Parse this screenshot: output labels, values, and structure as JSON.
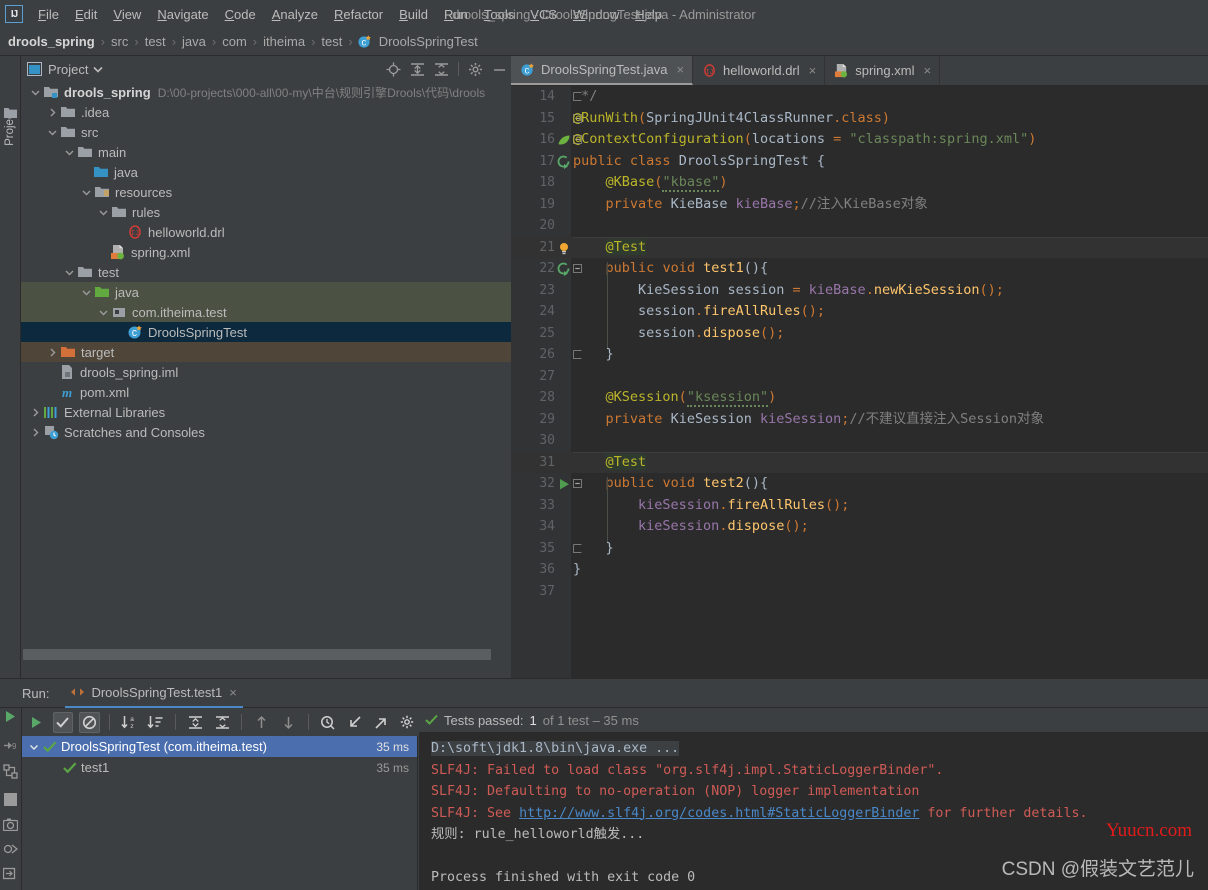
{
  "window": {
    "title": "drools_spring - DroolsSpringTest.java - Administrator"
  },
  "menubar": {
    "items": [
      {
        "label": "File"
      },
      {
        "label": "Edit"
      },
      {
        "label": "View"
      },
      {
        "label": "Navigate"
      },
      {
        "label": "Code"
      },
      {
        "label": "Analyze"
      },
      {
        "label": "Refactor"
      },
      {
        "label": "Build"
      },
      {
        "label": "Run"
      },
      {
        "label": "Tools"
      },
      {
        "label": "VCS"
      },
      {
        "label": "Window"
      },
      {
        "label": "Help"
      }
    ]
  },
  "breadcrumb": {
    "items": [
      {
        "label": "drools_spring",
        "bold": true
      },
      {
        "label": "src"
      },
      {
        "label": "test"
      },
      {
        "label": "java"
      },
      {
        "label": "com"
      },
      {
        "label": "itheima"
      },
      {
        "label": "test"
      },
      {
        "label": "DroolsSpringTest",
        "icon": "java-class-icon"
      }
    ],
    "separator": "›"
  },
  "left_strip": {
    "project_tab": "Project"
  },
  "project_panel": {
    "title": "Project",
    "dropdown_icon": "chevron-down-icon",
    "tools": [
      {
        "name": "locate-icon"
      },
      {
        "name": "expand-all-icon"
      },
      {
        "name": "collapse-all-icon"
      },
      {
        "name": "gear-icon"
      },
      {
        "name": "minimize-icon"
      }
    ],
    "tree": [
      {
        "label": "drools_spring",
        "path": "D:\\00-projects\\000-all\\00-my\\中台\\规则引擎Drools\\代码\\drools",
        "indent": 0,
        "arrow": "down",
        "icon": "module-icon",
        "bold": true
      },
      {
        "label": ".idea",
        "indent": 1,
        "arrow": "right",
        "icon": "folder-icon"
      },
      {
        "label": "src",
        "indent": 1,
        "arrow": "down",
        "icon": "folder-icon"
      },
      {
        "label": "main",
        "indent": 2,
        "arrow": "down",
        "icon": "folder-icon"
      },
      {
        "label": "java",
        "indent": 3,
        "arrow": "none",
        "icon": "folder-source-icon"
      },
      {
        "label": "resources",
        "indent": 3,
        "arrow": "down",
        "icon": "folder-resource-icon"
      },
      {
        "label": "rules",
        "indent": 4,
        "arrow": "down",
        "icon": "folder-icon"
      },
      {
        "label": "helloworld.drl",
        "indent": 5,
        "arrow": "none",
        "icon": "drl-file-icon"
      },
      {
        "label": "spring.xml",
        "indent": 4,
        "arrow": "none",
        "icon": "spring-xml-icon"
      },
      {
        "label": "test",
        "indent": 2,
        "arrow": "down",
        "icon": "folder-icon"
      },
      {
        "label": "java",
        "indent": 3,
        "arrow": "down",
        "icon": "folder-test-source-icon",
        "row": "srcroot"
      },
      {
        "label": "com.itheima.test",
        "indent": 4,
        "arrow": "down",
        "icon": "package-test-icon",
        "row": "srcroot"
      },
      {
        "label": "DroolsSpringTest",
        "indent": 5,
        "arrow": "none",
        "icon": "java-class-icon",
        "row": "sel"
      },
      {
        "label": "target",
        "indent": 1,
        "arrow": "right",
        "icon": "folder-excluded-icon",
        "row": "target"
      },
      {
        "label": "drools_spring.iml",
        "indent": 1,
        "arrow": "none",
        "icon": "iml-file-icon"
      },
      {
        "label": "pom.xml",
        "indent": 1,
        "arrow": "none",
        "icon": "maven-icon"
      },
      {
        "label": "External Libraries",
        "indent": 0,
        "arrow": "right",
        "icon": "libraries-icon"
      },
      {
        "label": "Scratches and Consoles",
        "indent": 0,
        "arrow": "right",
        "icon": "scratches-icon"
      }
    ]
  },
  "editor_tabs": [
    {
      "label": "DroolsSpringTest.java",
      "icon": "java-class-icon",
      "active": true,
      "close": "×"
    },
    {
      "label": "helloworld.drl",
      "icon": "drl-file-icon",
      "active": false,
      "close": "×"
    },
    {
      "label": "spring.xml",
      "icon": "spring-xml-icon",
      "active": false,
      "close": "×"
    }
  ],
  "editor": {
    "file": "DroolsSpringTest.java",
    "lines": [
      {
        "n": 14,
        "gicon": "",
        "fold": "end",
        "text": " */",
        "cls": "cmt"
      },
      {
        "n": 15,
        "gicon": "",
        "fold": "start",
        "text": "@RunWith(SpringJUnit4ClassRunner.class)"
      },
      {
        "n": 16,
        "gicon": "spring-leaf-icon",
        "fold": "start",
        "text": "@ContextConfiguration(locations = \"classpath:spring.xml\")"
      },
      {
        "n": 17,
        "gicon": "run-test-class-icon",
        "fold": "none",
        "text": "public class DroolsSpringTest {"
      },
      {
        "n": 18,
        "gicon": "",
        "fold": "none",
        "text": "    @KBase(\"kbase\")"
      },
      {
        "n": 19,
        "gicon": "",
        "fold": "none",
        "text": "    private KieBase kieBase;//注入KieBase对象"
      },
      {
        "n": 20,
        "gicon": "",
        "fold": "none",
        "text": ""
      },
      {
        "n": 21,
        "gicon": "intention-bulb-icon",
        "fold": "none",
        "text": "    @Test"
      },
      {
        "n": 22,
        "gicon": "run-test-method-icon",
        "fold": "start",
        "text": "    public void test1(){"
      },
      {
        "n": 23,
        "gicon": "",
        "fold": "none",
        "text": "        KieSession session = kieBase.newKieSession();"
      },
      {
        "n": 24,
        "gicon": "",
        "fold": "none",
        "text": "        session.fireAllRules();"
      },
      {
        "n": 25,
        "gicon": "",
        "fold": "none",
        "text": "        session.dispose();"
      },
      {
        "n": 26,
        "gicon": "",
        "fold": "end",
        "text": "    }"
      },
      {
        "n": 27,
        "gicon": "",
        "fold": "none",
        "text": ""
      },
      {
        "n": 28,
        "gicon": "",
        "fold": "none",
        "text": "    @KSession(\"ksession\")"
      },
      {
        "n": 29,
        "gicon": "",
        "fold": "none",
        "text": "    private KieSession kieSession;//不建议直接注入Session对象"
      },
      {
        "n": 30,
        "gicon": "",
        "fold": "none",
        "text": ""
      },
      {
        "n": 31,
        "gicon": "",
        "fold": "none",
        "text": "    @Test"
      },
      {
        "n": 32,
        "gicon": "run-arrow-icon",
        "fold": "start",
        "text": "    public void test2(){"
      },
      {
        "n": 33,
        "gicon": "",
        "fold": "none",
        "text": "        kieSession.fireAllRules();"
      },
      {
        "n": 34,
        "gicon": "",
        "fold": "none",
        "text": "        kieSession.dispose();"
      },
      {
        "n": 35,
        "gicon": "",
        "fold": "end",
        "text": "    }"
      },
      {
        "n": 36,
        "gicon": "",
        "fold": "none",
        "text": "}"
      },
      {
        "n": 37,
        "gicon": "",
        "fold": "none",
        "text": ""
      }
    ]
  },
  "run_panel": {
    "run_label": "Run:",
    "tab_label": "DroolsSpringTest.test1",
    "tab_icon": "run-config-icon",
    "tab_close": "×",
    "toolbar": [
      {
        "name": "rerun-icon"
      },
      {
        "name": "show-passed-icon",
        "pressed": true
      },
      {
        "name": "show-ignored-icon",
        "pressed": true
      },
      {
        "name": "sort-alphabetically-icon"
      },
      {
        "name": "sort-by-duration-icon"
      },
      {
        "name": "expand-all-icon"
      },
      {
        "name": "collapse-all-icon"
      },
      {
        "name": "prev-failed-icon"
      },
      {
        "name": "next-failed-icon"
      },
      {
        "name": "test-history-icon"
      },
      {
        "name": "import-tests-icon"
      },
      {
        "name": "export-tests-icon"
      },
      {
        "name": "settings-icon"
      }
    ],
    "side_icons": [
      {
        "name": "debug-icon"
      },
      {
        "name": "rerun-tests-icon"
      },
      {
        "name": "stop-icon"
      },
      {
        "name": "screenshot-icon"
      },
      {
        "name": "thread-dump-icon"
      },
      {
        "name": "scroll-to-end-icon"
      },
      {
        "name": "print-icon"
      }
    ],
    "tests": [
      {
        "label": "DroolsSpringTest (com.itheima.test)",
        "time": "35 ms",
        "status": "passed",
        "indent": 0,
        "selected": true,
        "arrow": "down"
      },
      {
        "label": "test1",
        "time": "35 ms",
        "status": "passed",
        "indent": 1,
        "selected": false,
        "arrow": "none"
      }
    ],
    "status": {
      "icon": "check-icon",
      "main": "Tests passed:",
      "count": "1",
      "detail": "of 1 test – 35 ms"
    },
    "console": [
      {
        "type": "cmd",
        "text": "D:\\soft\\jdk1.8\\bin\\java.exe ..."
      },
      {
        "type": "err",
        "text": "SLF4J: Failed to load class \"org.slf4j.impl.StaticLoggerBinder\"."
      },
      {
        "type": "err",
        "text": "SLF4J: Defaulting to no-operation (NOP) logger implementation"
      },
      {
        "type": "err_link",
        "prefix": "SLF4J: See ",
        "link": "http://www.slf4j.org/codes.html#StaticLoggerBinder",
        "suffix": " for further details."
      },
      {
        "type": "out",
        "text": "规则: rule_helloworld触发..."
      },
      {
        "type": "blank",
        "text": ""
      },
      {
        "type": "out",
        "text": "Process finished with exit code 0"
      }
    ],
    "watermark_1": "Yuucn.com",
    "watermark_2": "CSDN @假装文艺范儿"
  },
  "colors": {
    "bg_panel": "#3c3f41",
    "bg_editor": "#2b2b2b",
    "accent_blue": "#4b6eaf",
    "tab_underline": "#4a88c7",
    "green_pass": "#5aa544",
    "error_red": "#cf5b56",
    "srcroot_green": "#4b5243",
    "target_brown": "#4f4639",
    "selection_dark": "#0d293e"
  }
}
